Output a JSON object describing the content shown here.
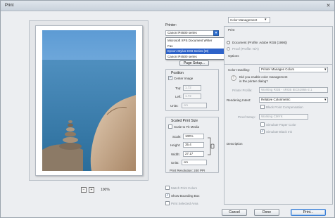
{
  "window": {
    "title": "Print"
  },
  "printer": {
    "section": "Printer:",
    "selected": "Canon iP4500 series",
    "options": [
      "Microsoft XPS Document Writer",
      "Fax",
      "Epson Stylus DX8 Series (M)",
      "Canon iP4500 series"
    ],
    "highlighted_option": "Epson Stylus DX8 Series (M)",
    "page_setup": "Page Setup..."
  },
  "position": {
    "section": "Position",
    "center_image": "Center Image",
    "top_label": "Top:",
    "top_value": "1.72",
    "left_label": "Left:",
    "left_value": "1.72",
    "units_label": "Units:",
    "units_value": "cm"
  },
  "scaled": {
    "section": "Scaled Print Size",
    "scale_to_fit": "Scale to Fit Media",
    "scale_label": "Scale:",
    "scale_value": "100%",
    "height_label": "Height:",
    "height_value": "35.4",
    "width_label": "Width:",
    "width_value": "27.17",
    "units_label": "Units:",
    "units_value": "cm",
    "resolution": "Print Resolution: 240 PPI"
  },
  "bottom_checks": {
    "match": "Match Print Colors",
    "bounding": "Show Bounding Box",
    "selected_area": "Print Selected Area"
  },
  "color": {
    "panel": "Color Management",
    "print_label": "Print",
    "document": "Document (Profile: Adobe RGB (1998))",
    "proof": "Proof (Profile: N/A)",
    "options": "Options",
    "handling_label": "Color Handling:",
    "handling_value": "Printer Manages Colors",
    "warning": "Did you enable color management in the printer dialog?",
    "printer_profile_label": "Printer Profile:",
    "printer_profile_value": "Working RGB - sRGB IEC61966-2.1",
    "intent_label": "Rendering Intent:",
    "intent_value": "Relative Colorimetric",
    "black_point": "Black Point Compensation",
    "proof_setup_label": "Proof Setup:",
    "proof_setup_value": "Working CMYK",
    "simulate_paper": "Simulate Paper Color",
    "simulate_black": "Simulate Black Ink",
    "description": "Description"
  },
  "buttons": {
    "cancel": "Cancel",
    "done": "Done",
    "print": "Print..."
  },
  "zoom": {
    "percent": "100%"
  },
  "colors": {
    "accent": "#2d62c9",
    "sky": "#6fa7d8",
    "sea": "#3a79a6",
    "rock": "#c9a98a"
  }
}
